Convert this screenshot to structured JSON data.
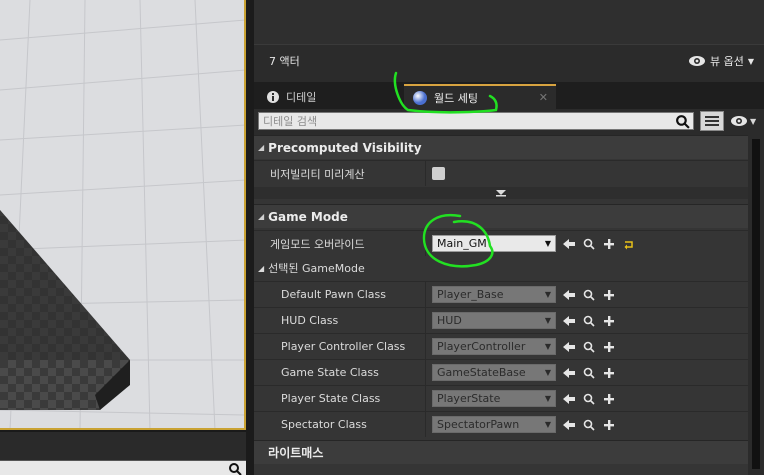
{
  "outliner": {
    "actor_count": "7 액터",
    "view_options": "뷰 옵션"
  },
  "tabs": {
    "details": "디테일",
    "world_settings": "월드 세팅"
  },
  "search": {
    "placeholder": "디테일 검색"
  },
  "categories": {
    "precomputed": {
      "title": "Precomputed Visibility",
      "row_label": "비저빌리티 미리계산"
    },
    "gamemode": {
      "title": "Game Mode",
      "override_label": "게임모드 오버라이드",
      "override_value": "Main_GM",
      "selected_label": "선택된 GameMode",
      "rows": [
        {
          "label": "Default Pawn Class",
          "value": "Player_Base"
        },
        {
          "label": "HUD Class",
          "value": "HUD"
        },
        {
          "label": "Player Controller Class",
          "value": "PlayerController"
        },
        {
          "label": "Game State Class",
          "value": "GameStateBase"
        },
        {
          "label": "Player State Class",
          "value": "PlayerState"
        },
        {
          "label": "Spectator Class",
          "value": "SpectatorPawn"
        }
      ]
    },
    "lightmass": {
      "title": "라이트매스"
    }
  },
  "colors": {
    "accent": "#d7a340",
    "annotation": "#22e022",
    "viewport_border": "#c9a233"
  },
  "icons": [
    "info-icon",
    "globe-icon",
    "search-icon",
    "list-view-icon",
    "eye-icon",
    "arrow-left-icon",
    "plus-icon",
    "reset-icon"
  ]
}
